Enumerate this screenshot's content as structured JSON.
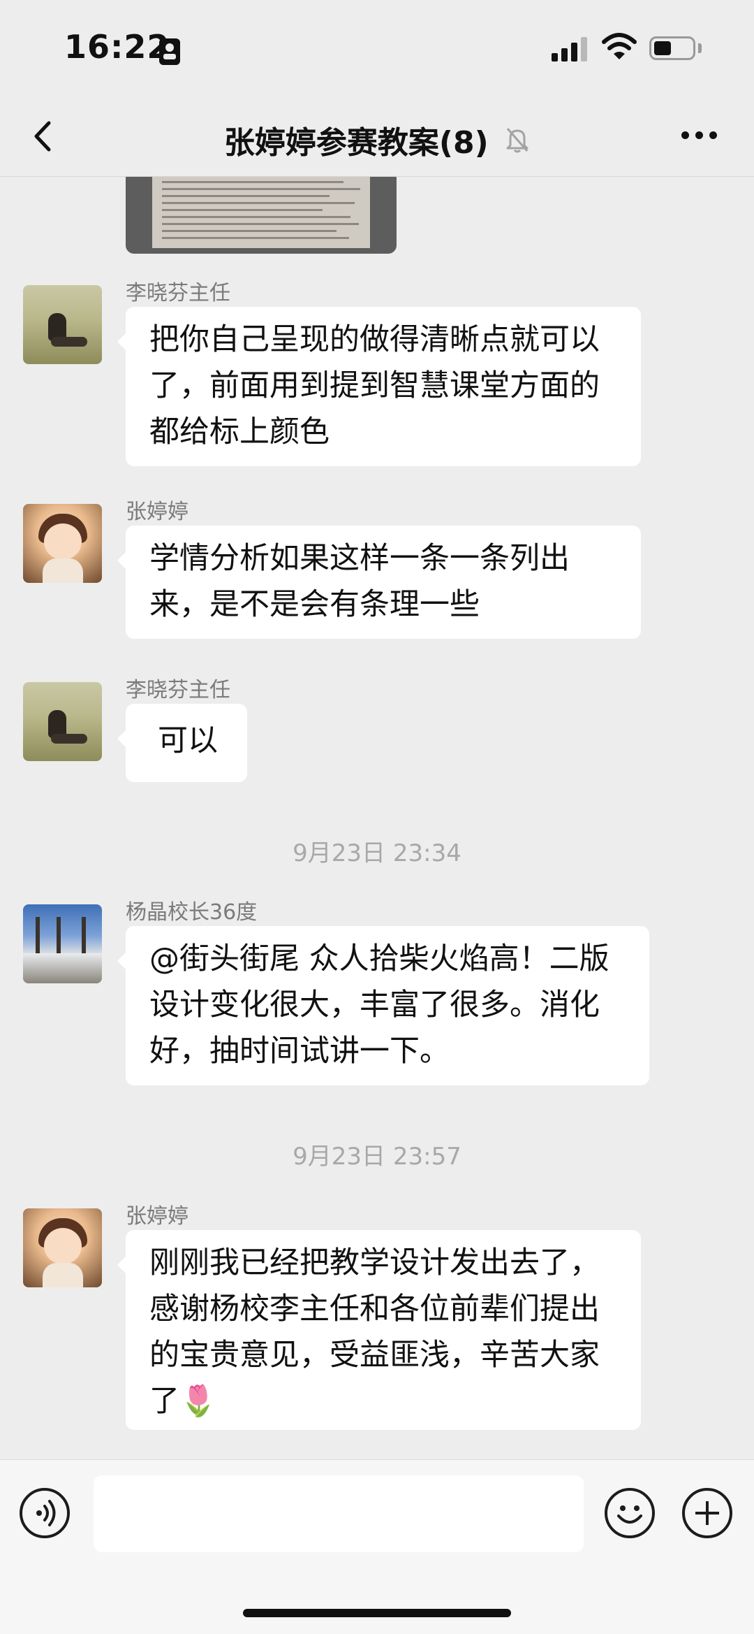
{
  "status_bar": {
    "time": "16:22"
  },
  "nav": {
    "title": "张婷婷参赛教案(8)"
  },
  "messages": [
    {
      "sender": "李晓芬主任",
      "text": "把你自己呈现的做得清晰点就可以了，前面用到提到智慧课堂方面的都给标上颜色"
    },
    {
      "sender": "张婷婷",
      "text": "学情分析如果这样一条一条列出来，是不是会有条理一些"
    },
    {
      "sender": "李晓芬主任",
      "text": "可以"
    },
    {
      "timestamp": "9月23日 23:34"
    },
    {
      "sender": "杨晶校长36度",
      "text": "@街头街尾 众人拾柴火焰高！二版设计变化很大，丰富了很多。消化好，抽时间试讲一下。"
    },
    {
      "timestamp": "9月23日 23:57"
    },
    {
      "sender": "张婷婷",
      "text": "刚刚我已经把教学设计发出去了，感谢杨校李主任和各位前辈们提出的宝贵意见，受益匪浅，辛苦大家了🌷"
    }
  ],
  "input_bar": {
    "message_value": ""
  }
}
